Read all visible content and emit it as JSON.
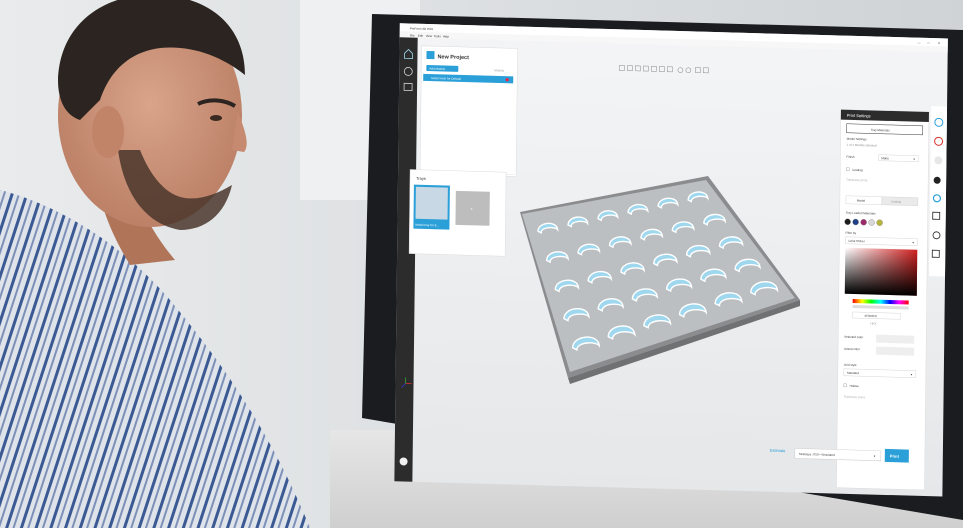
{
  "app": {
    "title": "PreForm 3D Print",
    "menu": [
      "File",
      "Edit",
      "View",
      "Tools",
      "Help"
    ]
  },
  "project": {
    "title": "New Project",
    "add_models_label": "Add Models",
    "models_header": "Models",
    "model_item": "Model Arch for Default"
  },
  "trays": {
    "header": "Trays",
    "tray_label": "Model tray for E...",
    "add_symbol": "+"
  },
  "print_settings": {
    "title": "Print Settings",
    "tray_materials_btn": "Tray Materials",
    "model_settings_header": "Model Settings",
    "models_selected": "1 of 1 Models selected",
    "finish_label": "Finish",
    "finish_value": "Matte",
    "coating_label": "Coating",
    "thickness_label": "Thickness (mm)",
    "tab_model": "Model",
    "tab_coating": "Coating",
    "tray_loaded_materials": "Tray Loaded Materials",
    "material_colors": [
      "#1c1c1c",
      "#1f3f86",
      "#9c2a6a",
      "#d8d8d8",
      "#b6b43a"
    ],
    "filter_by_label": "Filter by",
    "color_picker_value": "Color Picker",
    "hex_value": "#F0F0F0",
    "hex_sub": "HEX",
    "selected_color_label": "Selected color",
    "actual_color_label": "Actual color",
    "grid_style_label": "Grid style",
    "grid_style_value": "Standard",
    "hollow_label": "Hollow",
    "thickness2_label": "Thickness (mm)"
  },
  "bottom": {
    "estimate_label": "Estimate",
    "printer_value": "Stratasys J750 • Simulated",
    "print_btn": "Print"
  },
  "colors": {
    "accent": "#2a9fd8",
    "dark_panel": "#2c2c2c",
    "model_blue": "#9fd8ee"
  }
}
